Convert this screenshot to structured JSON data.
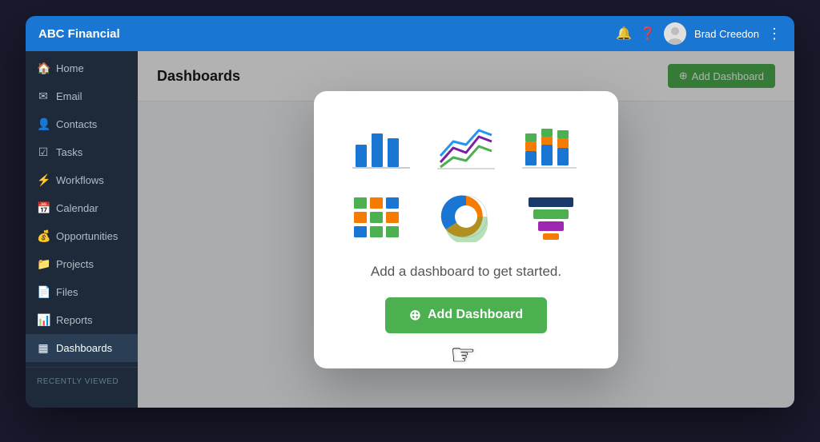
{
  "app": {
    "title": "ABC Financial",
    "brand_color": "#1976d2",
    "accent_color": "#4caf50"
  },
  "topbar": {
    "title": "ABC Financial",
    "user_name": "Brad Creedon",
    "bell_icon": "🔔",
    "help_icon": "❓",
    "more_icon": "⋮"
  },
  "sidebar": {
    "items": [
      {
        "label": "Home",
        "icon": "🏠",
        "active": false
      },
      {
        "label": "Email",
        "icon": "✉",
        "active": false
      },
      {
        "label": "Contacts",
        "icon": "👤",
        "active": false
      },
      {
        "label": "Tasks",
        "icon": "☑",
        "active": false
      },
      {
        "label": "Workflows",
        "icon": "⚡",
        "active": false
      },
      {
        "label": "Calendar",
        "icon": "📅",
        "active": false
      },
      {
        "label": "Opportunities",
        "icon": "💰",
        "active": false
      },
      {
        "label": "Projects",
        "icon": "📁",
        "active": false
      },
      {
        "label": "Files",
        "icon": "📄",
        "active": false
      },
      {
        "label": "Reports",
        "icon": "📊",
        "active": false
      },
      {
        "label": "Dashboards",
        "icon": "▦",
        "active": true
      }
    ],
    "section_label": "RECENTLY VIEWED"
  },
  "content": {
    "title": "Dashboards",
    "add_button_label": "+ Add Dashboard"
  },
  "modal": {
    "message": "Add a dashboard to get started.",
    "add_button_label": "Add Dashboard",
    "add_button_icon": "+"
  }
}
